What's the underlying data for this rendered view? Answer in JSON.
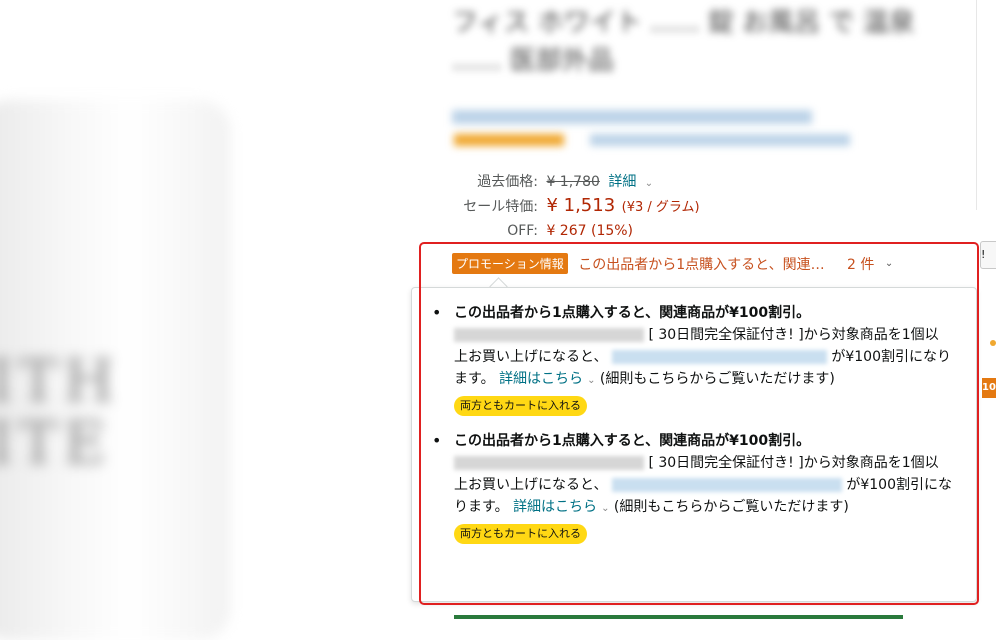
{
  "product": {
    "brand_watermark_line1": "ITH",
    "brand_watermark_line2": "ITE",
    "title_blurred": "フィス ホワイト ...... 錠 お風呂 で 温泉 ...... 医部外品"
  },
  "pricing": {
    "list_label": "過去価格:",
    "list_price": "¥ 1,780",
    "list_detail_link": "詳細",
    "sale_label": "セール特価:",
    "sale_price": "¥ 1,513",
    "unit_price": "(¥3 / グラム)",
    "off_label": "OFF:",
    "off_value": "¥ 267 (15%)"
  },
  "promotion": {
    "badge": "プロモーション情報",
    "summary": "この出品者から1点購入すると、関連…",
    "count": "2 件"
  },
  "offers": [
    {
      "title": "この出品者から1点購入すると、関連商品が¥100割引。",
      "text1": "[ 30日間完全保証付き! ]から対象商品を1個以上お買い上げになると、",
      "text2": "が¥100割引になります。",
      "detail_link": "詳細はこちら",
      "text3": "(細則もこちらからご覧いただけます)",
      "cart_button": "両方ともカートに入れる"
    },
    {
      "title": "この出品者から1点購入すると、関連商品が¥100割引。",
      "text1": "[ 30日間完全保証付き! ]から対象商品を1個以上お買い上げになると、",
      "text2": "が¥100割引になります。",
      "detail_link": "詳細はこちら",
      "text3": "(細則もこちらからご覧いただけます)",
      "cart_button": "両方ともカートに入れる"
    }
  ],
  "fragments": {
    "right_button": "!",
    "right_badge": "10"
  },
  "colors": {
    "price_red": "#b12704",
    "link_teal": "#007185",
    "promo_orange": "#e47911",
    "highlight_red": "#e02020",
    "cart_yellow": "#ffd814"
  }
}
